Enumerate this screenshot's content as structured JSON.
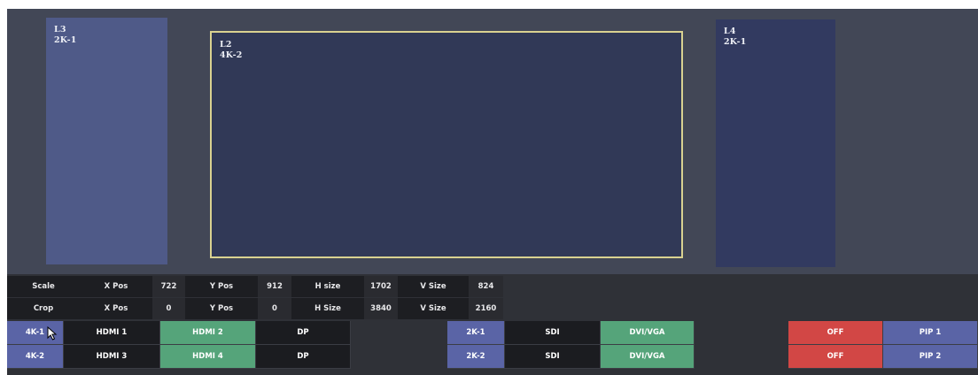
{
  "canvas": {
    "layers": [
      {
        "id": "l3",
        "name": "L3",
        "source": "2K-1"
      },
      {
        "id": "l2",
        "name": "L2",
        "source": "4K-2"
      },
      {
        "id": "l4",
        "name": "L4",
        "source": "2K-1"
      }
    ]
  },
  "info": {
    "scale_row": {
      "mode": "Scale",
      "x_pos_label": "X Pos",
      "x_pos": "722",
      "y_pos_label": "Y Pos",
      "y_pos": "912",
      "h_size_label": "H size",
      "h_size": "1702",
      "v_size_label": "V Size",
      "v_size": "824"
    },
    "crop_row": {
      "mode": "Crop",
      "x_pos_label": "X Pos",
      "x_pos": "0",
      "y_pos_label": "Y Pos",
      "y_pos": "0",
      "h_size_label": "H Size",
      "h_size": "3840",
      "v_size_label": "V Size",
      "v_size": "2160"
    }
  },
  "buttons": {
    "row1": {
      "output": "4K-1",
      "in1": "HDMI 1",
      "in2": "HDMI 2",
      "in3": "DP",
      "output2": "2K-1",
      "in4": "SDI",
      "in5": "DVI/VGA",
      "off": "OFF",
      "pip": "PIP 1"
    },
    "row2": {
      "output": "4K-2",
      "in1": "HDMI 3",
      "in2": "HDMI 4",
      "in3": "DP",
      "output2": "2K-2",
      "in4": "SDI",
      "in5": "DVI/VGA",
      "off": "OFF",
      "pip": "PIP 2"
    }
  },
  "colors": {
    "selected_output": "#5a64a6",
    "selected_input": "#55a47a",
    "off_button": "#d24745",
    "selected_layer_border": "#d9d290"
  },
  "icons": {
    "cursor": "mouse-pointer-icon"
  }
}
